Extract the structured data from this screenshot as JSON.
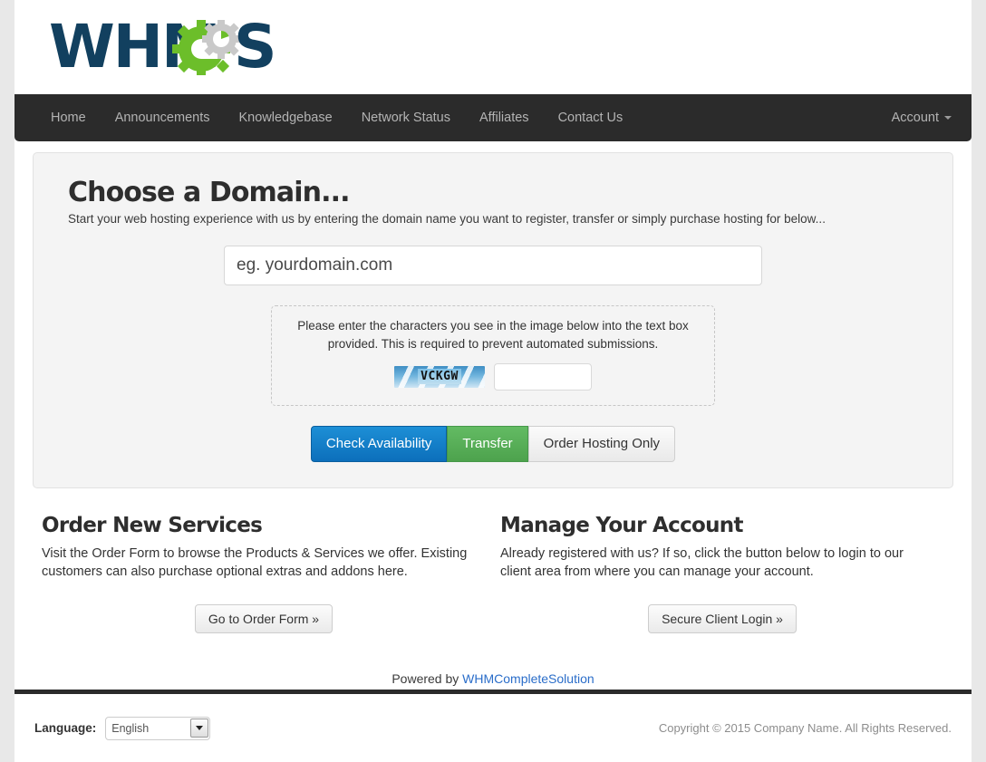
{
  "brand": {
    "logo_text": "WHMCS",
    "logo_alt": "whmcs-logo",
    "navy": "#12405f",
    "green": "#6cbe2a",
    "gray": "#c9c9c9"
  },
  "nav": {
    "items": [
      {
        "label": "Home"
      },
      {
        "label": "Announcements"
      },
      {
        "label": "Knowledgebase"
      },
      {
        "label": "Network Status"
      },
      {
        "label": "Affiliates"
      },
      {
        "label": "Contact Us"
      }
    ],
    "account": {
      "label": "Account"
    }
  },
  "domain_panel": {
    "title": "Choose a Domain...",
    "subtitle": "Start your web hosting experience with us by entering the domain name you want to register, transfer or simply purchase hosting for below...",
    "domain_input": {
      "value": "",
      "placeholder": "eg. yourdomain.com"
    },
    "captcha": {
      "instructions": "Please enter the characters you see in the image below into the text box provided. This is required to prevent automated submissions.",
      "code": "VCKGW",
      "input_value": "",
      "input_placeholder": ""
    },
    "buttons": {
      "check": "Check Availability",
      "transfer": "Transfer",
      "hosting_only": "Order Hosting Only"
    }
  },
  "columns": [
    {
      "title": "Order New Services",
      "text": "Visit the Order Form to browse the Products & Services we offer. Existing customers can also purchase optional extras and addons here.",
      "button": "Go to Order Form »"
    },
    {
      "title": "Manage Your Account",
      "text": "Already registered with us? If so, click the button below to login to our client area from where you can manage your account.",
      "button": "Secure Client Login »"
    }
  ],
  "powered": {
    "prefix": "Powered by ",
    "link": "WHMCompleteSolution"
  },
  "footer": {
    "language_label": "Language:",
    "language_value": "English",
    "language_options": [
      "English"
    ],
    "copyright": "Copyright © 2015 Company Name. All Rights Reserved."
  },
  "colors": {
    "navbar": "#2b2b2b",
    "primary": "#0c6fbb",
    "success": "#4da24d",
    "link": "#2a6dc9",
    "panel_bg": "#f4f4f4",
    "page_bg": "#e8e8e8"
  }
}
